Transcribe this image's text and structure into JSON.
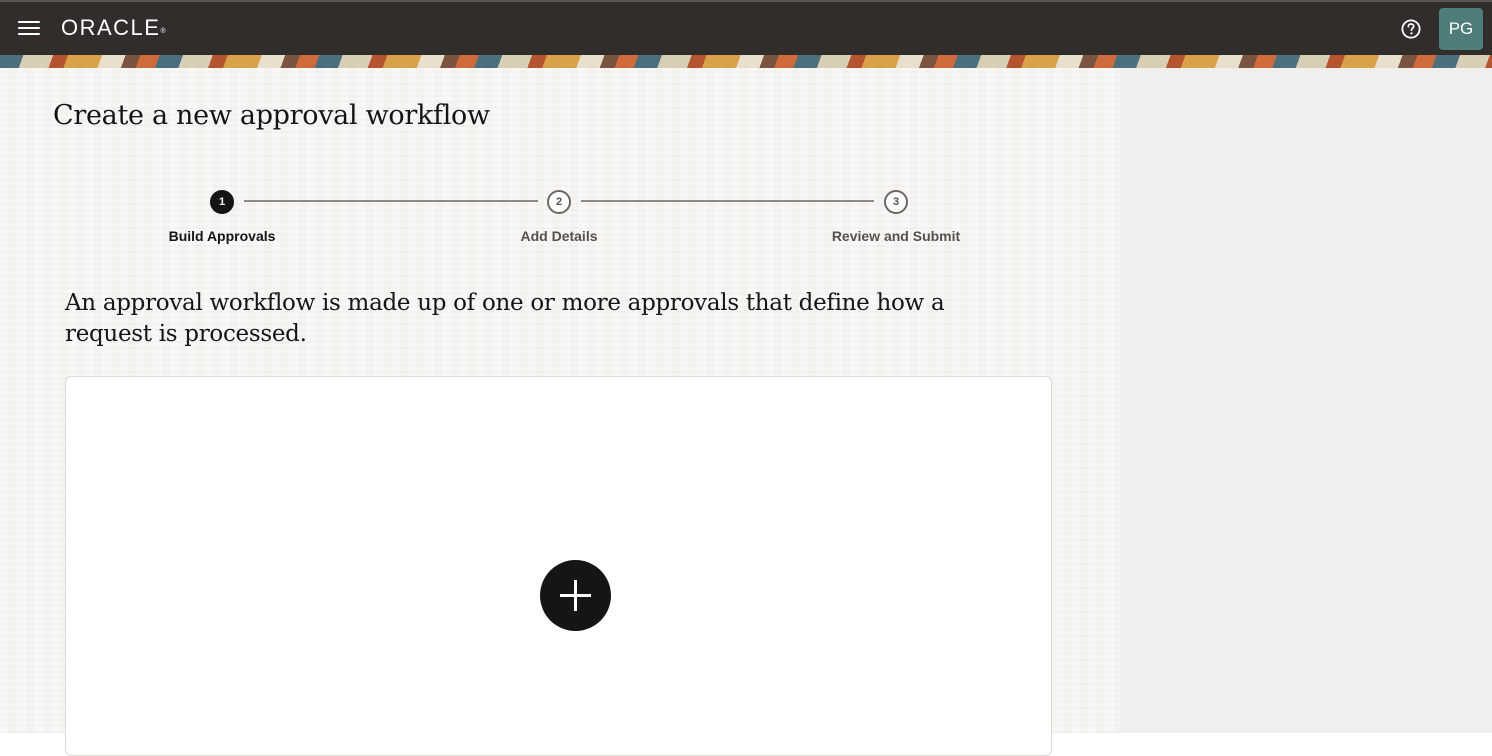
{
  "header": {
    "brand": "ORACLE",
    "brand_mark": "®",
    "menu_icon": "hamburger-menu-icon",
    "help_icon": "help-circle-icon",
    "user_initials": "PG",
    "colors": {
      "bar": "#312d2a",
      "avatar": "#4f7d7b"
    }
  },
  "page": {
    "title": "Create a new approval workflow",
    "intro": "An approval workflow is made up of one or more approvals that define how a request is processed."
  },
  "train": {
    "steps": [
      {
        "number": "1",
        "label": "Build Approvals",
        "state": "current"
      },
      {
        "number": "2",
        "label": "Add Details",
        "state": "upcoming"
      },
      {
        "number": "3",
        "label": "Review and Submit",
        "state": "upcoming"
      }
    ]
  },
  "canvas": {
    "add_icon": "plus-icon"
  }
}
